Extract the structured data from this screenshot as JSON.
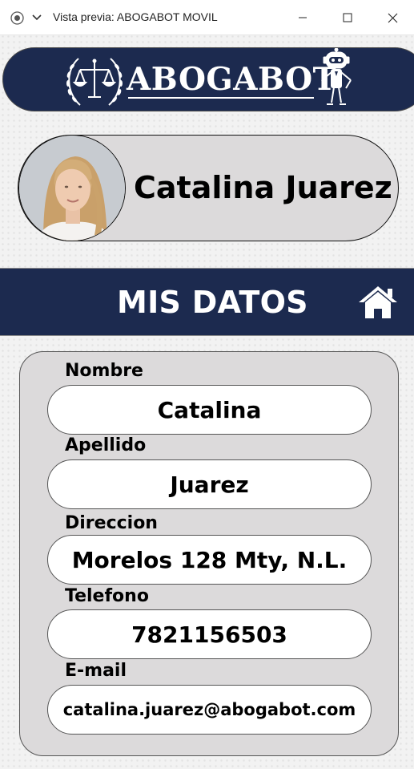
{
  "window": {
    "title": "Vista previa: ABOGABOT MOVIL"
  },
  "header": {
    "logo_text": "ABOGABOT"
  },
  "profile": {
    "name": "Catalina Juarez"
  },
  "section": {
    "title": "MIS DATOS"
  },
  "form": {
    "fields": [
      {
        "label": "Nombre",
        "value": "Catalina"
      },
      {
        "label": "Apellido",
        "value": "Juarez"
      },
      {
        "label": "Direccion",
        "value": "Morelos 128 Mty, N.L."
      },
      {
        "label": "Telefono",
        "value": "7821156503"
      },
      {
        "label": "E-mail",
        "value": "catalina.juarez@abogabot.com"
      }
    ]
  },
  "colors": {
    "navy": "#1c2a4f",
    "card_gray": "#dcdadb",
    "white": "#ffffff"
  },
  "icons": [
    "app-record-icon",
    "chevron-down-icon",
    "minimize-icon",
    "maximize-icon",
    "close-icon",
    "scales-of-justice-icon",
    "robot-icon",
    "home-icon"
  ]
}
